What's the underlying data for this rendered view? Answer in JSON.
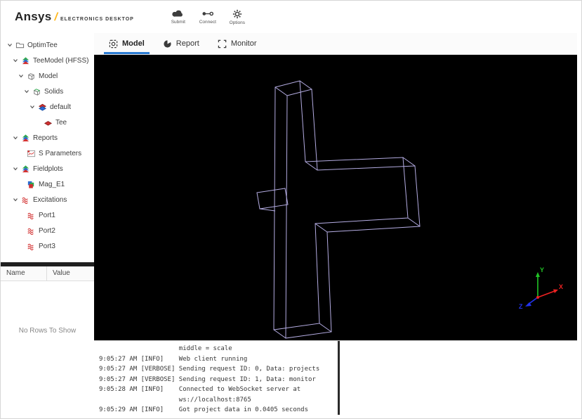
{
  "header": {
    "brand": {
      "name": "Ansys",
      "separator": "/",
      "product": "ELECTRONICS DESKTOP"
    },
    "actions": [
      {
        "label": "Submit",
        "icon": "cloud-icon"
      },
      {
        "label": "Connect",
        "icon": "connect-icon"
      },
      {
        "label": "Options",
        "icon": "gear-icon"
      }
    ]
  },
  "tabs": {
    "active": "Model",
    "items": [
      {
        "label": "Model",
        "icon": "model-tab-icon"
      },
      {
        "label": "Report",
        "icon": "report-tab-icon"
      },
      {
        "label": "Monitor",
        "icon": "monitor-tab-icon"
      }
    ]
  },
  "tree": {
    "items": [
      {
        "label": "OptimTee"
      },
      {
        "label": "TeeModel (HFSS)"
      },
      {
        "label": "Model"
      },
      {
        "label": "Solids"
      },
      {
        "label": "default"
      },
      {
        "label": "Tee"
      },
      {
        "label": "Reports"
      },
      {
        "label": "S Parameters"
      },
      {
        "label": "Fieldplots"
      },
      {
        "label": "Mag_E1"
      },
      {
        "label": "Excitations"
      },
      {
        "label": "Port1"
      },
      {
        "label": "Port2"
      },
      {
        "label": "Port3"
      }
    ]
  },
  "properties": {
    "columns": {
      "name": "Name",
      "value": "Value"
    },
    "empty": "No Rows To Show"
  },
  "viewport": {
    "axis_labels": {
      "x": "X",
      "y": "Y",
      "z": "Z"
    },
    "axis_colors": {
      "x": "#ee2222",
      "y": "#21c326",
      "z": "#2233ee"
    },
    "wireframe_color": "#b4ace2",
    "background": "#000000"
  },
  "console": {
    "lines": [
      "                     middle = scale",
      "9:05:27 AM [INFO]    Web client running",
      "9:05:27 AM [VERBOSE] Sending request ID: 0, Data: projects",
      "9:05:27 AM [VERBOSE] Sending request ID: 1, Data: monitor",
      "9:05:28 AM [INFO]    Connected to WebSocket server at",
      "                     ws://localhost:8765",
      "9:05:29 AM [INFO]    Got project data in 0.0405 seconds"
    ]
  }
}
